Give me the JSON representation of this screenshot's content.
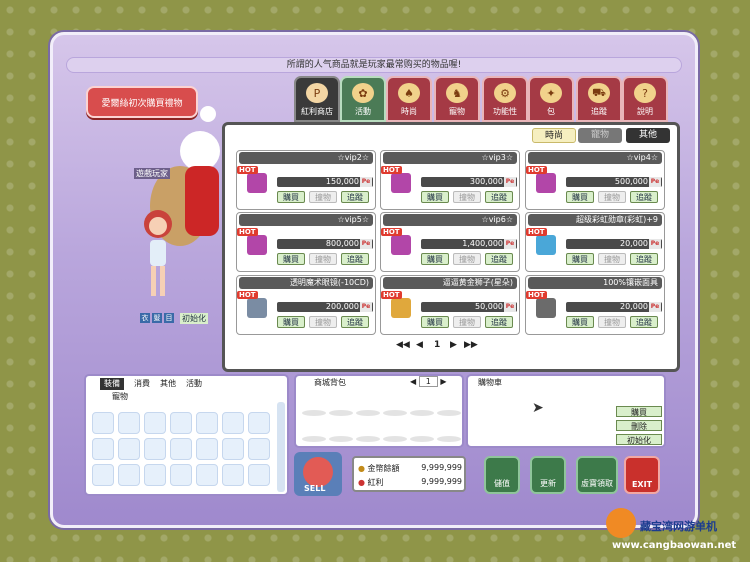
{
  "notice": "所謂的人气商品就是玩家最常购买的物品喔!",
  "gift_button": "愛爾絲初次購買禮物",
  "main_tabs": [
    {
      "label": "紅利商店",
      "icon": "p-coin-icon"
    },
    {
      "label": "活動",
      "icon": "event-icon"
    },
    {
      "label": "時尚",
      "icon": "fashion-icon"
    },
    {
      "label": "寵物",
      "icon": "pet-icon"
    },
    {
      "label": "功能性",
      "icon": "gear-icon"
    },
    {
      "label": "包",
      "icon": "bag-icon"
    },
    {
      "label": "追蹤",
      "icon": "cart-icon"
    },
    {
      "label": "說明",
      "icon": "help-icon"
    }
  ],
  "sub_tabs": [
    "時尚",
    "寵物",
    "其他"
  ],
  "character": {
    "name": "遊戲玩家",
    "buttons": [
      "衣",
      "髮",
      "目"
    ],
    "reset": "初始化"
  },
  "currency_symbol": "Pe",
  "buttons": {
    "buy": "購買",
    "try": "撞物",
    "track": "追蹤"
  },
  "hot_label": "HOT",
  "items": [
    {
      "name": "☆vip2☆",
      "price": "150,000"
    },
    {
      "name": "☆vip3☆",
      "price": "300,000"
    },
    {
      "name": "☆vip4☆",
      "price": "500,000"
    },
    {
      "name": "☆vip5☆",
      "price": "800,000"
    },
    {
      "name": "☆vip6☆",
      "price": "1,400,000"
    },
    {
      "name": "超级彩虹勋章(彩虹)+9",
      "price": "20,000"
    },
    {
      "name": "透明魔术眼镜(-10CD)",
      "price": "200,000"
    },
    {
      "name": "逼逼黄金狮子(星朵)",
      "price": "50,000"
    },
    {
      "name": "100%镶嵌面具",
      "price": "20,000"
    }
  ],
  "pager": {
    "page": "1"
  },
  "inventory": {
    "tabs": [
      "裝備",
      "消費",
      "其他",
      "活動"
    ],
    "second_row": "寵物"
  },
  "bag": {
    "title": "商城背包",
    "page": "1"
  },
  "cart": {
    "title": "購物車",
    "buttons": [
      "購買",
      "刪除",
      "初始化"
    ]
  },
  "wallet": [
    {
      "label": "金幣餘額",
      "value": "9,999,999"
    },
    {
      "label": "紅利",
      "value": "9,999,999"
    }
  ],
  "action_buttons": [
    "儲值",
    "更新",
    "虛寶領取",
    "EXIT"
  ],
  "sell_label": "SELL",
  "watermark": {
    "brand": "藏宝湾网游单机",
    "url": "www.cangbaowan.net"
  }
}
